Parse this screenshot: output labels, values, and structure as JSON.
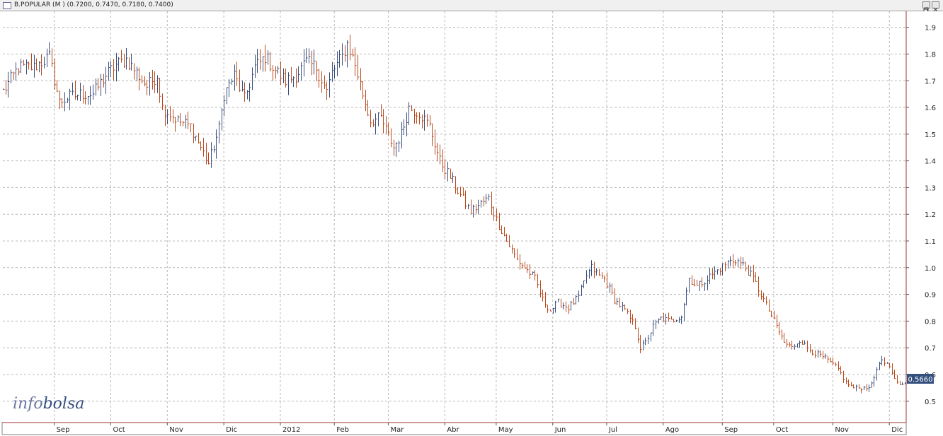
{
  "window": {
    "title": "B.POPULAR (M ) (0.7200, 0.7470, 0.7180, 0.7400)"
  },
  "logo": {
    "part1": "info",
    "part2": "bolsa",
    "color1": "#6a78a0",
    "color2": "#34507e"
  },
  "colors": {
    "up": "#3a4e7c",
    "down": "#b84a1e",
    "grid": "#b8b8b8",
    "frame": "#a03030",
    "last_price_bg": "#34507e"
  },
  "chart_data": {
    "type": "ohlc",
    "instrument": "B.POPULAR",
    "ylim": [
      0.42,
      1.96
    ],
    "y_ticks": [
      0.5,
      0.6,
      0.7,
      0.8,
      0.9,
      1.0,
      1.1,
      1.2,
      1.3,
      1.4,
      1.5,
      1.6,
      1.7,
      1.8,
      1.9
    ],
    "y_tick_labels": [
      "0.5",
      "0.6",
      "0.7",
      "0.8",
      "0.9",
      "1.0",
      "1.1",
      "1.2",
      "1.3",
      "1.4",
      "1.5",
      "1.6",
      "1.7",
      "1.8",
      "1.9"
    ],
    "x_labels": [
      "Sep",
      "Oct",
      "Nov",
      "Dic",
      "2012",
      "Feb",
      "Mar",
      "Abr",
      "May",
      "Jun",
      "Jul",
      "Ago",
      "Sep",
      "Oct",
      "Nov",
      "Dic"
    ],
    "x_label_sessions": [
      20,
      42,
      64,
      86,
      108,
      129,
      150,
      172,
      192,
      214,
      235,
      257,
      280,
      300,
      323,
      345
    ],
    "sessions": 352,
    "last_price": "0.5660",
    "grid": true,
    "anchors": [
      [
        0,
        1.66
      ],
      [
        6,
        1.75
      ],
      [
        12,
        1.75
      ],
      [
        18,
        1.79
      ],
      [
        22,
        1.62
      ],
      [
        26,
        1.64
      ],
      [
        30,
        1.65
      ],
      [
        35,
        1.65
      ],
      [
        40,
        1.72
      ],
      [
        44,
        1.76
      ],
      [
        48,
        1.78
      ],
      [
        52,
        1.73
      ],
      [
        56,
        1.68
      ],
      [
        60,
        1.72
      ],
      [
        62,
        1.6
      ],
      [
        68,
        1.55
      ],
      [
        73,
        1.53
      ],
      [
        78,
        1.43
      ],
      [
        80,
        1.39
      ],
      [
        84,
        1.52
      ],
      [
        86,
        1.65
      ],
      [
        90,
        1.72
      ],
      [
        94,
        1.63
      ],
      [
        98,
        1.75
      ],
      [
        102,
        1.79
      ],
      [
        106,
        1.74
      ],
      [
        110,
        1.7
      ],
      [
        114,
        1.72
      ],
      [
        118,
        1.77
      ],
      [
        122,
        1.75
      ],
      [
        126,
        1.66
      ],
      [
        128,
        1.73
      ],
      [
        132,
        1.79
      ],
      [
        134,
        1.84
      ],
      [
        137,
        1.76
      ],
      [
        140,
        1.65
      ],
      [
        143,
        1.55
      ],
      [
        147,
        1.56
      ],
      [
        152,
        1.45
      ],
      [
        155,
        1.5
      ],
      [
        158,
        1.6
      ],
      [
        162,
        1.58
      ],
      [
        166,
        1.53
      ],
      [
        170,
        1.4
      ],
      [
        174,
        1.34
      ],
      [
        178,
        1.27
      ],
      [
        182,
        1.21
      ],
      [
        186,
        1.24
      ],
      [
        189,
        1.26
      ],
      [
        192,
        1.18
      ],
      [
        196,
        1.1
      ],
      [
        200,
        1.03
      ],
      [
        204,
        0.99
      ],
      [
        207,
        0.96
      ],
      [
        210,
        0.88
      ],
      [
        213,
        0.84
      ],
      [
        216,
        0.87
      ],
      [
        220,
        0.85
      ],
      [
        224,
        0.89
      ],
      [
        227,
        0.97
      ],
      [
        229,
        1.0
      ],
      [
        232,
        0.97
      ],
      [
        234,
        0.96
      ],
      [
        238,
        0.88
      ],
      [
        242,
        0.84
      ],
      [
        246,
        0.78
      ],
      [
        248,
        0.7
      ],
      [
        250,
        0.72
      ],
      [
        253,
        0.78
      ],
      [
        256,
        0.81
      ],
      [
        260,
        0.8
      ],
      [
        264,
        0.82
      ],
      [
        267,
        0.96
      ],
      [
        270,
        0.93
      ],
      [
        274,
        0.96
      ],
      [
        278,
        0.99
      ],
      [
        282,
        1.02
      ],
      [
        285,
        1.03
      ],
      [
        288,
        1.01
      ],
      [
        292,
        0.96
      ],
      [
        295,
        0.9
      ],
      [
        298,
        0.84
      ],
      [
        301,
        0.78
      ],
      [
        304,
        0.72
      ],
      [
        307,
        0.7
      ],
      [
        310,
        0.73
      ],
      [
        313,
        0.7
      ],
      [
        316,
        0.68
      ],
      [
        320,
        0.66
      ],
      [
        325,
        0.62
      ],
      [
        328,
        0.57
      ],
      [
        331,
        0.55
      ],
      [
        335,
        0.55
      ],
      [
        338,
        0.56
      ],
      [
        341,
        0.65
      ],
      [
        344,
        0.64
      ],
      [
        347,
        0.58
      ],
      [
        350,
        0.56
      ],
      [
        351,
        0.566
      ]
    ]
  }
}
